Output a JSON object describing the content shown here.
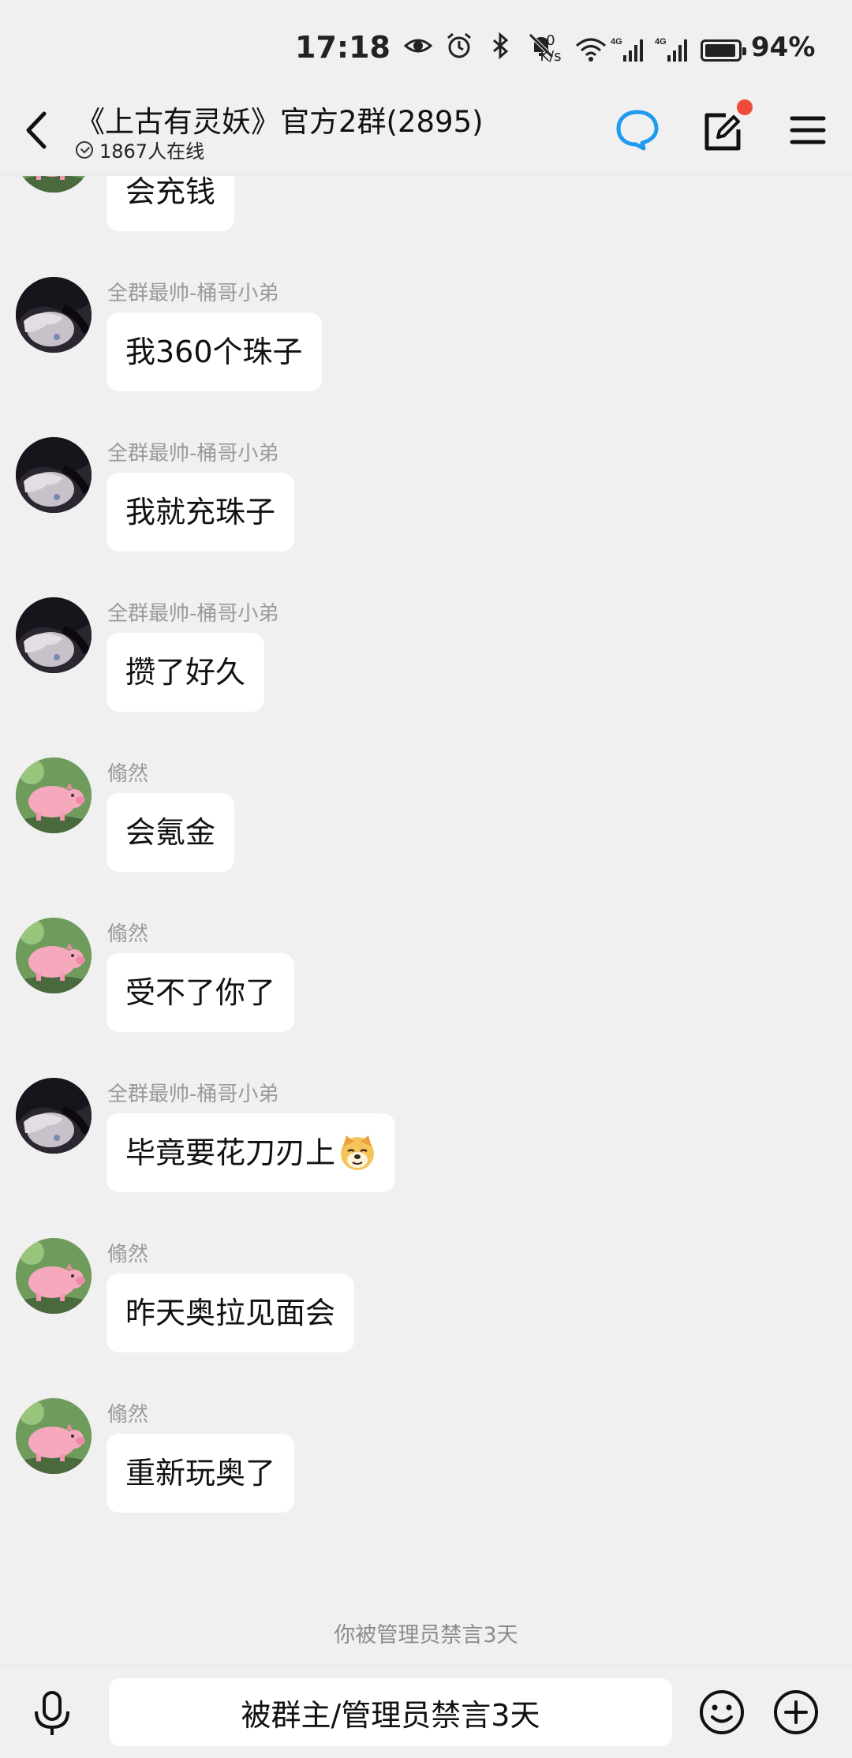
{
  "status_bar": {
    "time": "17:18",
    "net_speed_value": "0",
    "net_speed_unit": "K/s",
    "signal_1_label": "4G",
    "signal_2_label": "4G",
    "battery_percent": "94%",
    "battery_level": 0.94,
    "icons": [
      "eye-icon",
      "alarm-icon",
      "bluetooth-icon",
      "mute-bell-icon",
      "wifi-icon",
      "signal-icon",
      "signal-icon",
      "battery-icon"
    ]
  },
  "header": {
    "title": "《上古有灵妖》官方2群(2895)",
    "online_text": "1867人在线",
    "notification_dot_color": "#f04b3a",
    "accent_color": "#1e9bf0"
  },
  "messages": [
    {
      "avatar": "pig-avatar",
      "sender": "",
      "text": "会充钱",
      "emoji": ""
    },
    {
      "avatar": "anime-girl-avatar",
      "sender": "全群最帅-桶哥小弟",
      "text": "我360个珠子",
      "emoji": ""
    },
    {
      "avatar": "anime-girl-avatar",
      "sender": "全群最帅-桶哥小弟",
      "text": "我就充珠子",
      "emoji": ""
    },
    {
      "avatar": "anime-girl-avatar",
      "sender": "全群最帅-桶哥小弟",
      "text": "攒了好久",
      "emoji": ""
    },
    {
      "avatar": "pig-avatar",
      "sender": "翛然",
      "text": "会氪金",
      "emoji": ""
    },
    {
      "avatar": "pig-avatar",
      "sender": "翛然",
      "text": "受不了你了",
      "emoji": ""
    },
    {
      "avatar": "anime-girl-avatar",
      "sender": "全群最帅-桶哥小弟",
      "text": "毕竟要花刀刃上",
      "emoji": "doge-emoji"
    },
    {
      "avatar": "pig-avatar",
      "sender": "翛然",
      "text": "昨天奥拉见面会",
      "emoji": ""
    },
    {
      "avatar": "pig-avatar",
      "sender": "翛然",
      "text": "重新玩奥了",
      "emoji": ""
    }
  ],
  "system_note": "你被管理员禁言3天",
  "input_bar": {
    "muted_text": "被群主/管理员禁言3天"
  }
}
